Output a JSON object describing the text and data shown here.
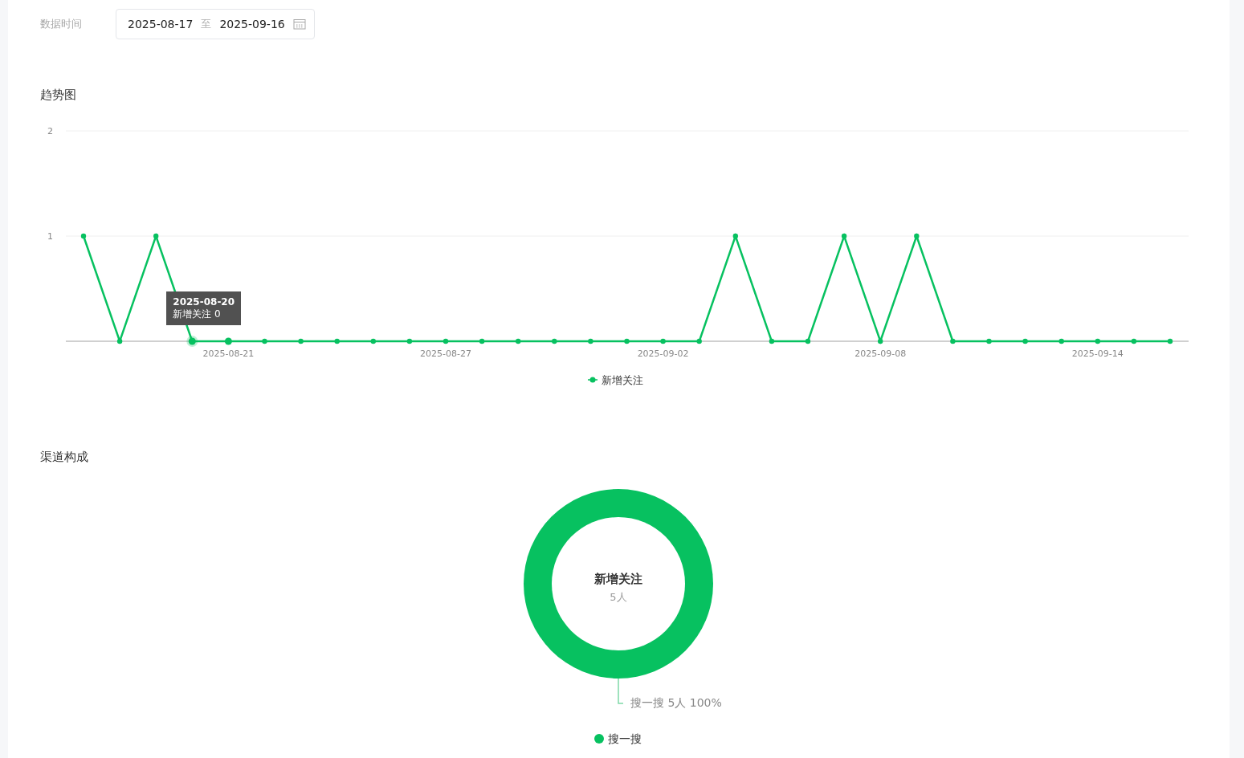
{
  "filter": {
    "label": "数据时间",
    "start": "2025-08-17",
    "separator": "至",
    "end": "2025-09-16"
  },
  "trend": {
    "title": "趋势图",
    "tooltip": {
      "title": "2025-08-20",
      "text": "新增关注 0"
    },
    "chart_data": {
      "type": "line",
      "categories": [
        null,
        null,
        null,
        null,
        "2025-08-21",
        null,
        null,
        null,
        null,
        null,
        "2025-08-27",
        null,
        null,
        null,
        null,
        null,
        "2025-09-02",
        null,
        null,
        null,
        null,
        null,
        "2025-09-08",
        null,
        null,
        null,
        null,
        null,
        "2025-09-14",
        null,
        null
      ],
      "series": [
        {
          "name": "新增关注",
          "color": "#07c160",
          "marker": true,
          "values": [
            1,
            0,
            1,
            0,
            0,
            0,
            0,
            0,
            0,
            0,
            0,
            0,
            0,
            0,
            0,
            0,
            0,
            0,
            1,
            0,
            0,
            1,
            0,
            1,
            0,
            0,
            0,
            0,
            0,
            0,
            0
          ]
        }
      ],
      "ylim": [
        0,
        2
      ],
      "yticks": [
        1,
        2
      ]
    }
  },
  "channels": {
    "title": "渠道构成",
    "center_title": "新增关注",
    "center_value": "5人",
    "chart_data": {
      "type": "donut",
      "categories": [
        "搜一搜"
      ],
      "series": [
        {
          "color": "#07c160",
          "values": [
            100
          ]
        }
      ],
      "value_labels": [
        "搜一搜 5人 100%"
      ]
    }
  }
}
